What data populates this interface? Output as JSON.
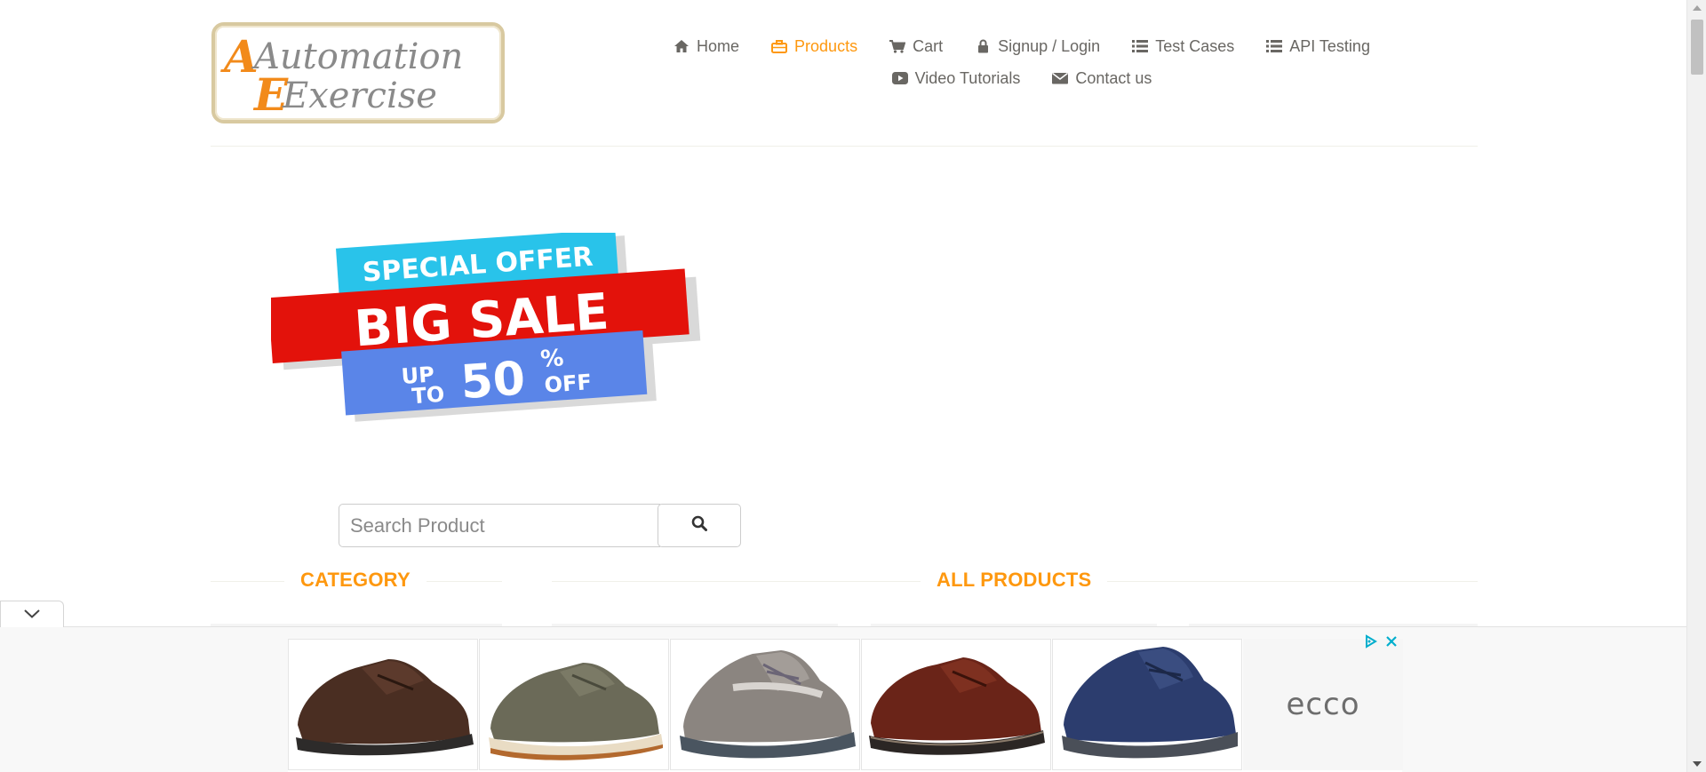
{
  "logo": {
    "line1": "Automation",
    "line2": "Exercise"
  },
  "nav": {
    "row1": [
      {
        "label": "Home",
        "icon": "home-icon",
        "active": false
      },
      {
        "label": "Products",
        "icon": "briefcase-icon",
        "active": true
      },
      {
        "label": "Cart",
        "icon": "cart-icon",
        "active": false
      },
      {
        "label": "Signup / Login",
        "icon": "lock-icon",
        "active": false
      },
      {
        "label": "Test Cases",
        "icon": "list-icon",
        "active": false
      },
      {
        "label": "API Testing",
        "icon": "list-icon",
        "active": false
      }
    ],
    "row2": [
      {
        "label": "Video Tutorials",
        "icon": "youtube-icon",
        "active": false
      },
      {
        "label": "Contact us",
        "icon": "envelope-icon",
        "active": false
      }
    ]
  },
  "banner": {
    "line1": "SPECIAL OFFER",
    "line2": "BIG SALE",
    "up": "UP",
    "to": "TO",
    "percent": "50",
    "percent_sign": "%",
    "off": "OFF"
  },
  "search": {
    "placeholder": "Search Product",
    "value": ""
  },
  "sections": {
    "category": "CATEGORY",
    "all_products": "ALL PRODUCTS"
  },
  "ad": {
    "brand": "ecco",
    "products": [
      "brown-leather-shoe",
      "olive-suede-derby",
      "grey-sneaker",
      "cognac-derby",
      "navy-sneaker"
    ]
  },
  "colors": {
    "accent": "#fe980f",
    "text": "#696763",
    "banner_red": "#e3120b",
    "banner_cyan": "#29c3ea",
    "banner_blue": "#5a85e8"
  }
}
